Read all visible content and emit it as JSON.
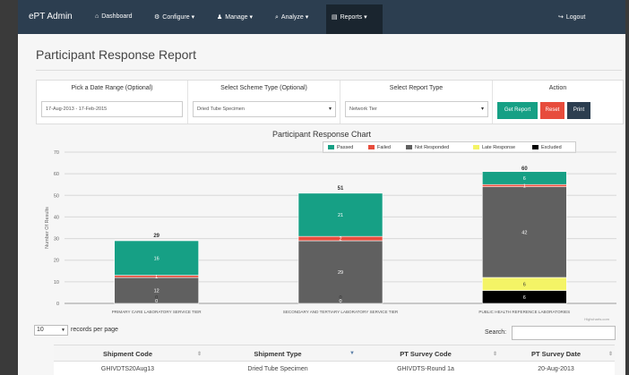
{
  "nav": {
    "brand": "ePT Admin",
    "items": [
      {
        "icon": "dashboard-icon",
        "glyph": "⌂",
        "label": "Dashboard"
      },
      {
        "icon": "gear-icon",
        "glyph": "⚙",
        "label": "Configure ▾"
      },
      {
        "icon": "user-icon",
        "glyph": "♟",
        "label": "Manage ▾"
      },
      {
        "icon": "search-icon",
        "glyph": "⌕",
        "label": "Analyze ▾"
      },
      {
        "icon": "chart-icon",
        "glyph": "▤",
        "label": "Reports ▾"
      }
    ],
    "logout": "Logout",
    "logout_glyph": "↪"
  },
  "page": {
    "title": "Participant Response Report"
  },
  "filters": {
    "date_header": "Pick a Date Range (Optional)",
    "date_value": "17-Aug-2013 - 17-Feb-2015",
    "scheme_header": "Select Scheme Type (Optional)",
    "scheme_value": "Dried Tube Specimen",
    "report_header": "Select Report Type",
    "report_value": "Network Tier",
    "action_header": "Action",
    "get_report": "Get Report",
    "reset": "Reset",
    "print": "Print"
  },
  "chart_data": {
    "type": "bar",
    "stacked": true,
    "title": "Participant Response Chart",
    "ylabel": "Number Of Results",
    "xlabel": "",
    "ylim": [
      0,
      70
    ],
    "yticks": [
      0,
      10,
      20,
      30,
      40,
      50,
      60,
      70
    ],
    "categories": [
      "PRIMARY CARE LABORATORY SERVICE TIER",
      "SECONDARY AND TERTIARY LABORATORY SERVICE TIER",
      "PUBLIC HEALTH REFERENCE LABORATORIES"
    ],
    "totals": [
      29,
      51,
      60
    ],
    "series": [
      {
        "name": "Excluded",
        "color": "#000000",
        "values": [
          0,
          0,
          6
        ]
      },
      {
        "name": "Late Response",
        "color": "#f4f466",
        "values": [
          0,
          0,
          6
        ]
      },
      {
        "name": "Not Responded",
        "color": "#606060",
        "values": [
          12,
          29,
          42
        ]
      },
      {
        "name": "Failed",
        "color": "#e74c3c",
        "values": [
          1,
          2,
          1
        ]
      },
      {
        "name": "Passed",
        "color": "#16a085",
        "values": [
          16,
          20,
          6
        ]
      }
    ],
    "segment_labels": [
      [
        "0",
        "0",
        "12",
        "1",
        "16"
      ],
      [
        "0",
        "0",
        "29",
        "2",
        "21"
      ],
      [
        "6",
        "6",
        "42",
        "1",
        "6"
      ]
    ],
    "legend_order": [
      "Passed",
      "Failed",
      "Not Responded",
      "Late Response",
      "Excluded"
    ],
    "legend_position": "top-right",
    "credit": "Highcharts.com",
    "grid": true
  },
  "table": {
    "length_value": "10",
    "length_label": "records per page",
    "search_label": "Search:",
    "columns": [
      "Shipment Code",
      "Shipment Type",
      "PT Survey Code",
      "PT Survey Date"
    ],
    "rows": [
      [
        "GHIVDTS20Aug13",
        "Dried Tube Specimen",
        "GHIVDTS-Round 1a",
        "20-Aug-2013"
      ]
    ]
  }
}
